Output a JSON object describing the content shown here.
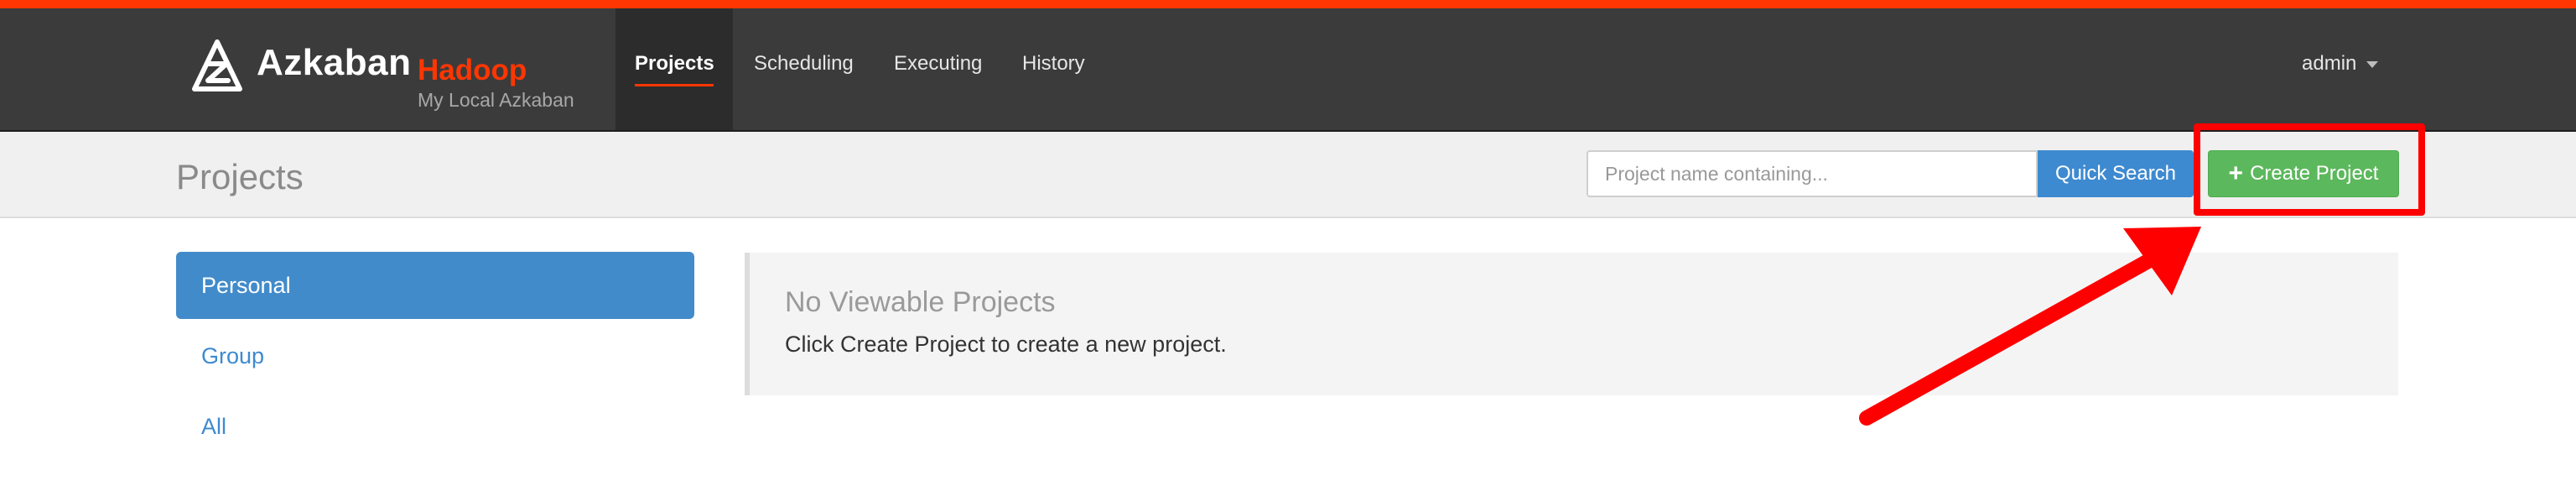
{
  "navbar": {
    "brand_name": "Azkaban",
    "brand_env": "Hadoop",
    "brand_sub": "My Local Azkaban",
    "items": [
      {
        "label": "Projects",
        "active": true
      },
      {
        "label": "Scheduling",
        "active": false
      },
      {
        "label": "Executing",
        "active": false
      },
      {
        "label": "History",
        "active": false
      }
    ],
    "user": "admin"
  },
  "header": {
    "title": "Projects",
    "search_placeholder": "Project name containing...",
    "quick_search_label": "Quick Search",
    "create_project_label": "Create Project"
  },
  "sidebar": {
    "items": [
      {
        "label": "Personal",
        "active": true
      },
      {
        "label": "Group",
        "active": false
      },
      {
        "label": "All",
        "active": false
      }
    ]
  },
  "main": {
    "empty_title": "No Viewable Projects",
    "empty_text": "Click Create Project to create a new project."
  },
  "colors": {
    "accent": "#ff3601",
    "navbar_bg": "#3b3b3b",
    "primary_blue": "#428bca",
    "success_green": "#5cb85c",
    "annotation_red": "#ff0000"
  },
  "icons": {
    "logo": "azkaban-logo-icon",
    "caret": "caret-down-icon",
    "plus": "plus-icon",
    "annotation_arrow": "arrow-icon"
  }
}
